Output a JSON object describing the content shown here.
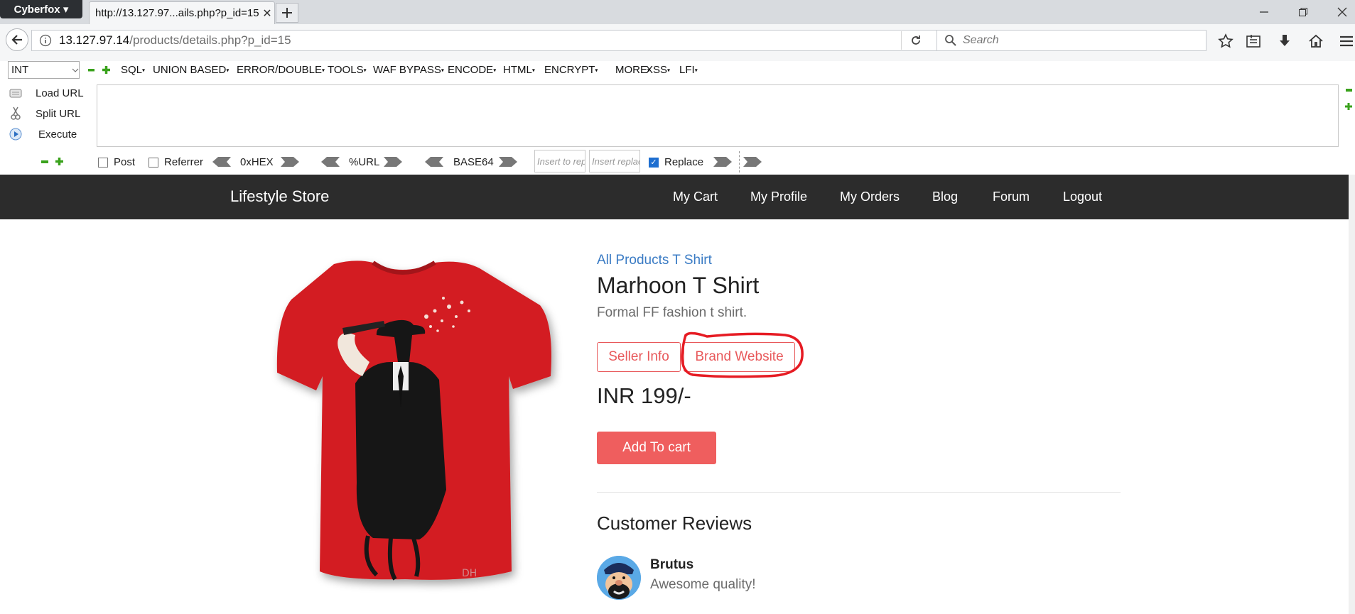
{
  "browser": {
    "app_menu": "Cyberfox",
    "tab_title": "http://13.127.97...ails.php?p_id=15",
    "url_host": "13.127.97.14",
    "url_path": "/products/details.php?p_id=15",
    "search_placeholder": "Search"
  },
  "hackbar": {
    "select_value": "INT",
    "menus": [
      "SQL",
      "UNION BASED",
      "ERROR/DOUBLE",
      "TOOLS",
      "WAF BYPASS",
      "ENCODE",
      "HTML",
      "ENCRYPT",
      "MORE",
      "XSS",
      "LFI"
    ],
    "load_url": "Load URL",
    "split_url": "Split URL",
    "execute": "Execute",
    "post_label": "Post",
    "post_checked": false,
    "referrer_label": "Referrer",
    "referrer_checked": false,
    "hex_label": "0xHEX",
    "url_label": "%URL",
    "base64_label": "BASE64",
    "insert_to_placeholder": "Insert to rep",
    "insert_replace_placeholder": "Insert replac",
    "replace_label": "Replace",
    "replace_checked": true
  },
  "site": {
    "brand": "Lifestyle Store",
    "nav": [
      "My Cart",
      "My Profile",
      "My Orders",
      "Blog",
      "Forum",
      "Logout"
    ]
  },
  "product": {
    "breadcrumb": "All Products T Shirt",
    "title": "Marhoon T Shirt",
    "description": "Formal FF fashion t shirt.",
    "seller_info": "Seller Info",
    "brand_website": "Brand Website",
    "price": "INR 199/-",
    "add_to_cart": "Add To cart",
    "accent_color": "#ef5e5e"
  },
  "reviews": {
    "title": "Customer Reviews",
    "items": [
      {
        "name": "Brutus",
        "text": "Awesome quality!"
      }
    ]
  }
}
